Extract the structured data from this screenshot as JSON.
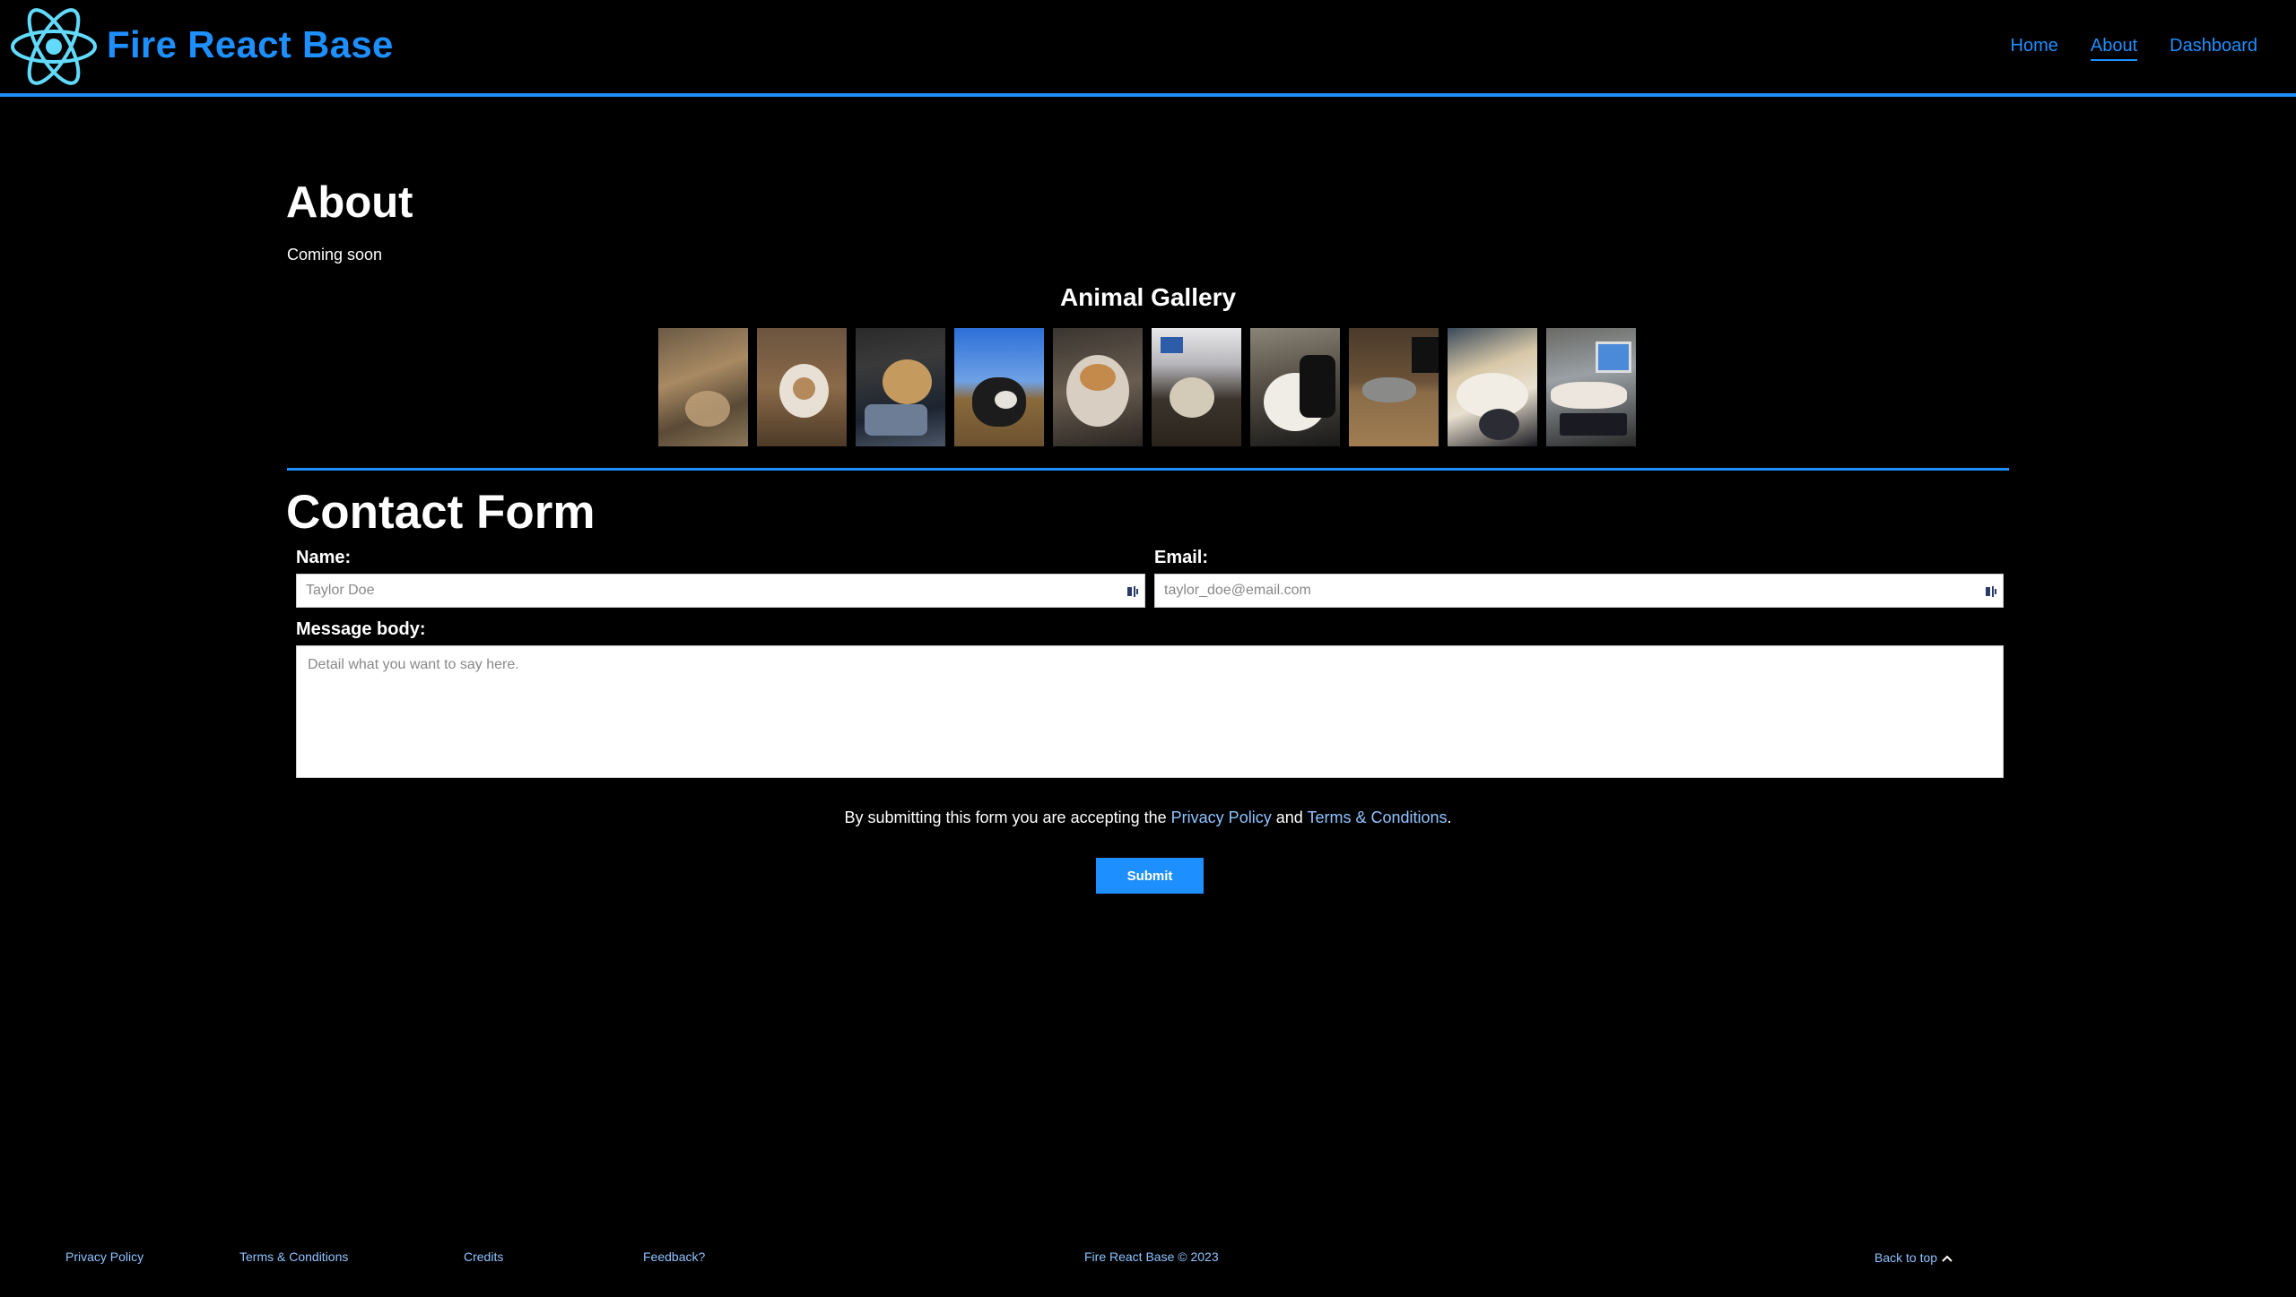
{
  "header": {
    "brand": "Fire React Base",
    "nav": [
      "Home",
      "About",
      "Dashboard"
    ],
    "active_nav": "About",
    "accent_color": "#1e8fff"
  },
  "about": {
    "title": "About",
    "subtitle": "Coming soon"
  },
  "gallery": {
    "title": "Animal Gallery",
    "photo_count": 10
  },
  "contact": {
    "title": "Contact Form",
    "name_label": "Name:",
    "name_placeholder": "Taylor Doe",
    "email_label": "Email:",
    "email_placeholder": "taylor_doe@email.com",
    "message_label": "Message body:",
    "message_placeholder": "Detail what you want to say here.",
    "terms_prefix": "By submitting this form you are accepting the",
    "privacy_link": "Privacy Policy",
    "terms_and": "and",
    "terms_link": "Terms & Conditions",
    "terms_suffix": ".",
    "submit_label": "Submit"
  },
  "footer": {
    "privacy": "Privacy Policy",
    "terms": "Terms & Conditions",
    "credits": "Credits",
    "feedback": "Feedback?",
    "copyright": "Fire React Base © 2023",
    "back_to_top": "Back to top"
  }
}
